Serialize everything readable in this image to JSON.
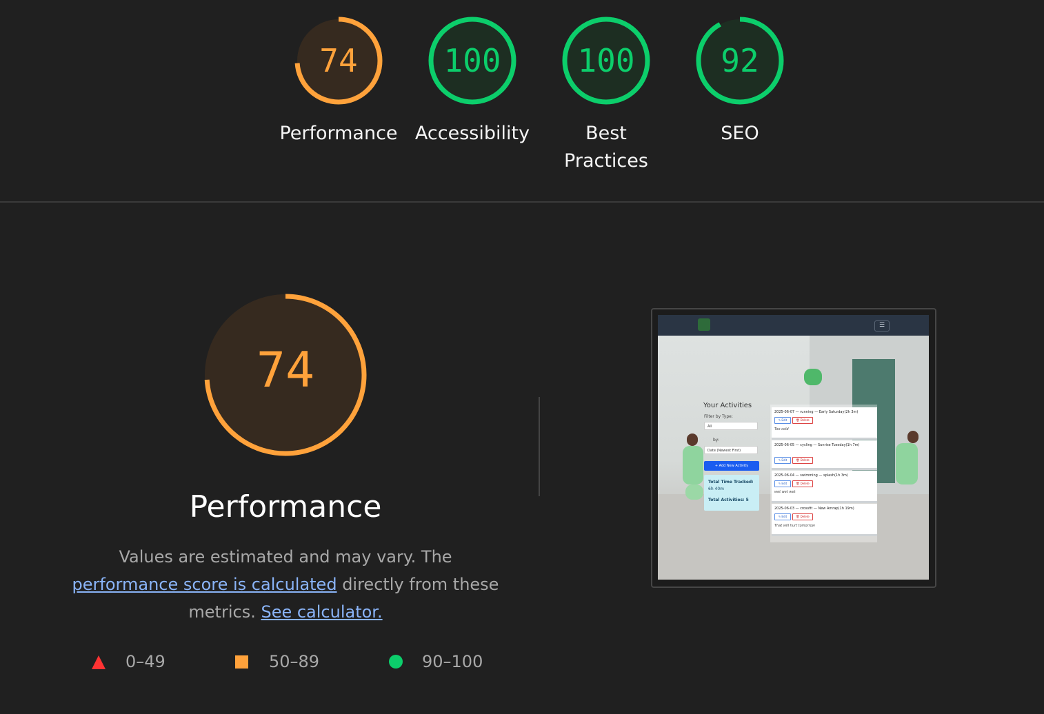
{
  "categories": [
    {
      "label": "Performance",
      "score": 74,
      "fraction": 0.74,
      "color": "#ffa23b",
      "bg": "#362a1f"
    },
    {
      "label": "Accessibility",
      "score": 100,
      "fraction": 1.0,
      "color": "#0cce6b",
      "bg": "#1d2e22"
    },
    {
      "label_line1": "Best",
      "label_line2": "Practices",
      "score": 100,
      "fraction": 1.0,
      "color": "#0cce6b",
      "bg": "#1d2e22"
    },
    {
      "label": "SEO",
      "score": 92,
      "fraction": 0.92,
      "color": "#0cce6b",
      "bg": "#1d2e22"
    }
  ],
  "detail": {
    "score": 74,
    "fraction": 0.74,
    "title": "Performance",
    "desc_part1": "Values are estimated and may vary. The ",
    "desc_link1": "performance score is calculated",
    "desc_part2": " directly from these metrics. ",
    "desc_link2": "See calculator."
  },
  "legend": {
    "fail": "0–49",
    "average": "50–89",
    "pass": "90–100"
  },
  "screenshot": {
    "menu_icon": "☰",
    "heading": "Your Activities",
    "filter_label": "Filter by Type:",
    "filter_value": "All",
    "sort_label": "by:",
    "sort_value": "Date (Newest First)",
    "add_button": "+ Add New Activity",
    "total_time_label": "Total Time Tracked:",
    "total_time_value": "6h 40m",
    "total_count_label": "Total Activities: 5",
    "edit_label": "✎ Edit",
    "delete_label": "🗑 Delete",
    "activities": [
      {
        "header": "2025-06-07 — running — Early Saturday(2h 3m)",
        "note": "Too cold"
      },
      {
        "header": "2025-06-05 — cycling — Sunrise Tuesday(1h 7m)",
        "note": ""
      },
      {
        "header": "2025-06-04 — swimming — splash(1h 3m)",
        "note": "wet wet wet"
      },
      {
        "header": "2025-06-03 — crossfit — New Amrap(1h 19m)",
        "note": "That will hurt tomorrow"
      }
    ]
  }
}
